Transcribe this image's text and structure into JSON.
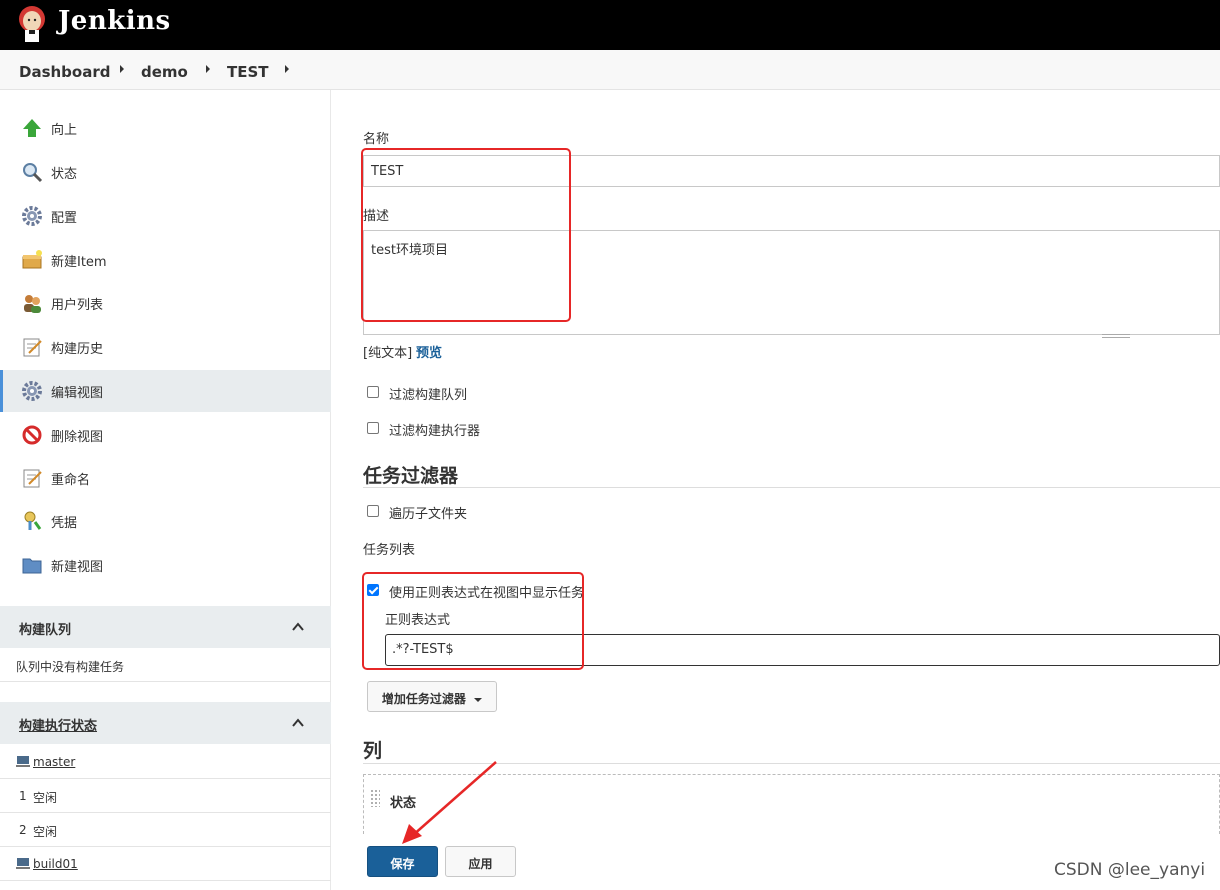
{
  "header": {
    "brand": "Jenkins"
  },
  "breadcrumb": [
    "Dashboard",
    "demo",
    "TEST"
  ],
  "sidebar": {
    "tasks": [
      {
        "label": "向上",
        "icon": "up-arrow-icon"
      },
      {
        "label": "状态",
        "icon": "magnifier-icon"
      },
      {
        "label": "配置",
        "icon": "gear-icon"
      },
      {
        "label": "新建Item",
        "icon": "new-item-box-icon"
      },
      {
        "label": "用户列表",
        "icon": "users-icon"
      },
      {
        "label": "构建历史",
        "icon": "notepad-icon"
      },
      {
        "label": "编辑视图",
        "icon": "gear-icon"
      },
      {
        "label": "删除视图",
        "icon": "no-entry-icon"
      },
      {
        "label": "重命名",
        "icon": "notepad-icon"
      },
      {
        "label": "凭据",
        "icon": "keys-icon"
      },
      {
        "label": "新建视图",
        "icon": "folder-icon"
      }
    ],
    "active_task": "编辑视图",
    "build_queue": {
      "title": "构建队列",
      "empty_text": "队列中没有构建任务"
    },
    "executors": {
      "title": "构建执行状态",
      "nodes": [
        {
          "name": "master",
          "executors": [
            {
              "num": "1",
              "status": "空闲"
            },
            {
              "num": "2",
              "status": "空闲"
            }
          ]
        },
        {
          "name": "build01"
        }
      ]
    }
  },
  "form": {
    "name_label": "名称",
    "name_value": "TEST",
    "desc_label": "描述",
    "desc_value": "test环境项目",
    "plain_text": "[纯文本]",
    "preview": "预览",
    "filter_queue": "过滤构建队列",
    "filter_executors": "过滤构建执行器",
    "job_filters_heading": "任务过滤器",
    "recurse": "遍历子文件夹",
    "job_list_label": "任务列表",
    "use_regex": "使用正则表达式在视图中显示任务",
    "regex_label": "正则表达式",
    "regex_value": ".*?-TEST$",
    "add_filter": "增加任务过滤器",
    "columns_heading": "列",
    "column_status": "状态",
    "save": "保存",
    "apply": "应用"
  },
  "watermark": "CSDN @lee_yanyi",
  "colors": {
    "primary_button": "#1a6099",
    "highlight_box": "#e62727",
    "active_bar": "#4a90d9"
  }
}
